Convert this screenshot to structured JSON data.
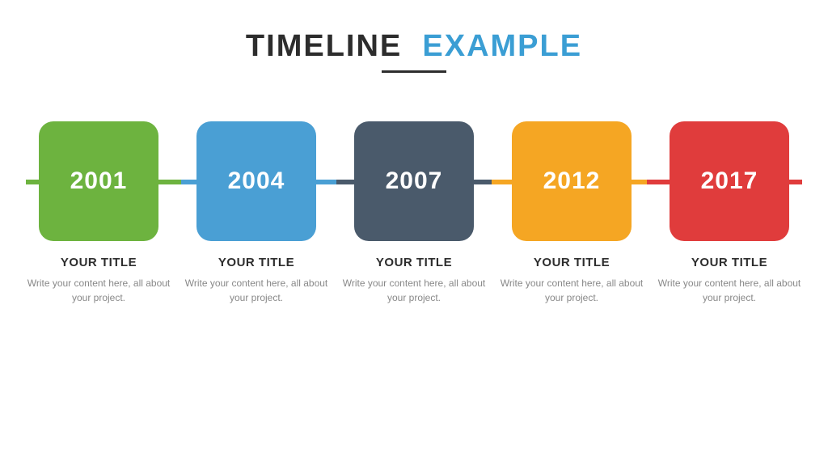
{
  "header": {
    "title_part1": "TIMELINE",
    "title_part2": "EXAMPLE",
    "underline": true
  },
  "timeline": {
    "items": [
      {
        "year": "2001",
        "color_class": "box-green",
        "title": "YOUR TITLE",
        "description": "Write your content here, all about your project."
      },
      {
        "year": "2004",
        "color_class": "box-blue",
        "title": "YOUR TITLE",
        "description": "Write your content here, all about your project."
      },
      {
        "year": "2007",
        "color_class": "box-dark",
        "title": "YOUR TITLE",
        "description": "Write your content here, all about your project."
      },
      {
        "year": "2012",
        "color_class": "box-orange",
        "title": "YOUR TITLE",
        "description": "Write your content here, all about your project."
      },
      {
        "year": "2017",
        "color_class": "box-red",
        "title": "YOUR TITLE",
        "description": "Write your content here, all about your project."
      }
    ]
  }
}
